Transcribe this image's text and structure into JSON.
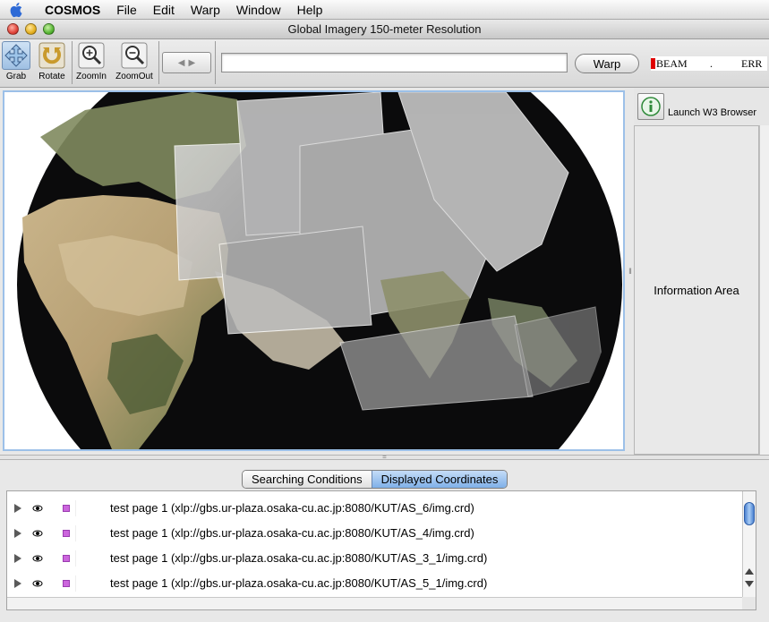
{
  "menubar": {
    "app_name": "COSMOS",
    "items": [
      "File",
      "Edit",
      "Warp",
      "Window",
      "Help"
    ]
  },
  "window": {
    "title": "Global Imagery 150-meter Resolution"
  },
  "toolbar": {
    "tools": [
      {
        "label": "Grab",
        "icon": "grab-icon"
      },
      {
        "label": "Rotate",
        "icon": "rotate-icon"
      },
      {
        "label": "ZoomIn",
        "icon": "zoom-in-icon"
      },
      {
        "label": "ZoomOut",
        "icon": "zoom-out-icon"
      }
    ],
    "url_value": "",
    "warp_label": "Warp",
    "beam": {
      "text1": "BEAM",
      "text2": ".",
      "text3": "ERR",
      "indicator_color": "#e00000"
    }
  },
  "map": {
    "ocean_color": "#0a0a0a",
    "background": "#ffffff"
  },
  "sidebar": {
    "launch_label": "Launch W3 Browser",
    "info_label": "Information Area"
  },
  "tabs": [
    {
      "label": "Searching Conditions",
      "active": false
    },
    {
      "label": "Displayed Coordinates",
      "active": true
    }
  ],
  "list": {
    "rows": [
      {
        "text": "test page 1 (xlp://gbs.ur-plaza.osaka-cu.ac.jp:8080/KUT/AS_6/img.crd)"
      },
      {
        "text": "test page 1 (xlp://gbs.ur-plaza.osaka-cu.ac.jp:8080/KUT/AS_4/img.crd)"
      },
      {
        "text": "test page 1 (xlp://gbs.ur-plaza.osaka-cu.ac.jp:8080/KUT/AS_3_1/img.crd)"
      },
      {
        "text": "test page 1 (xlp://gbs.ur-plaza.osaka-cu.ac.jp:8080/KUT/AS_5_1/img.crd)"
      }
    ]
  }
}
